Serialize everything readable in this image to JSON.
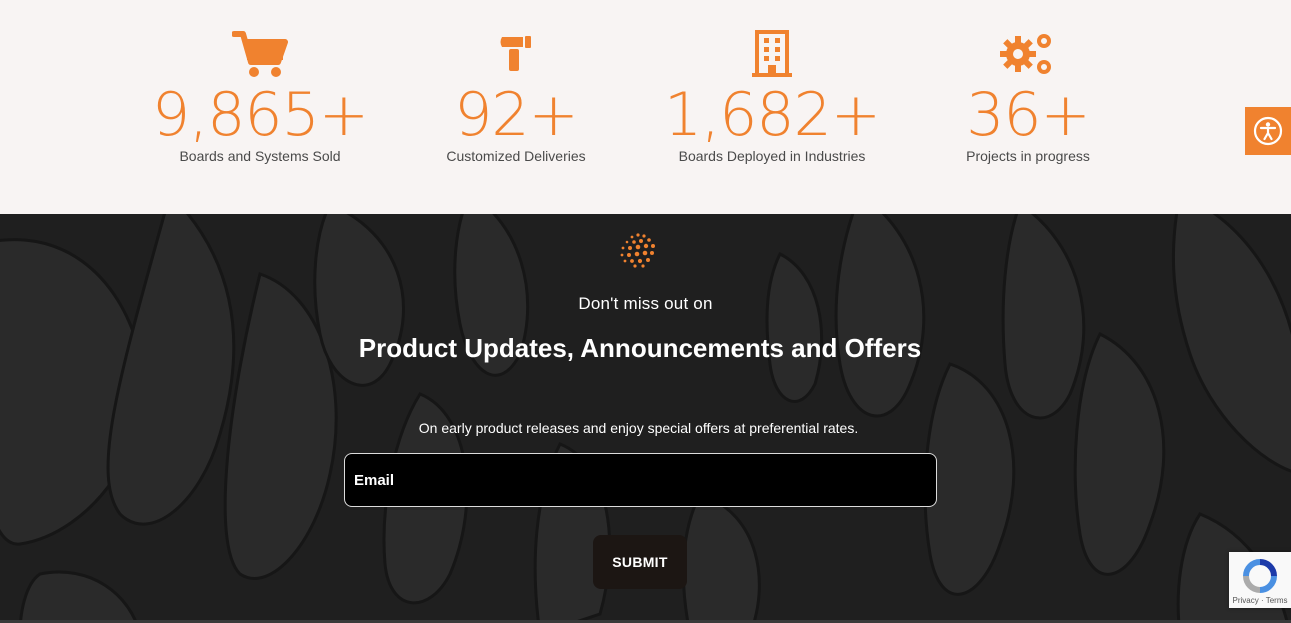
{
  "stats": [
    {
      "icon": "cart-icon",
      "value": "9,865+",
      "label": "Boards and Systems Sold"
    },
    {
      "icon": "hammer-icon",
      "value": "92+",
      "label": "Customized Deliveries"
    },
    {
      "icon": "building-icon",
      "value": "1,682+",
      "label": "Boards Deployed in Industries"
    },
    {
      "icon": "gears-icon",
      "value": "36+",
      "label": "Projects in progress"
    }
  ],
  "newsletter": {
    "eyebrow": "Don't miss out on",
    "heading": "Product Updates, Announcements and Offers",
    "subtext": "On early product releases and enjoy special offers at preferential rates.",
    "email_placeholder": "Email",
    "submit_label": "SUBMIT"
  },
  "recaptcha": {
    "privacy": "Privacy",
    "separator": "·",
    "terms": "Terms"
  },
  "colors": {
    "accent": "#f0822f",
    "stats_bg": "#f8f4f3",
    "section_bg": "#1f1f1f",
    "label_text": "#4a4a4a"
  }
}
